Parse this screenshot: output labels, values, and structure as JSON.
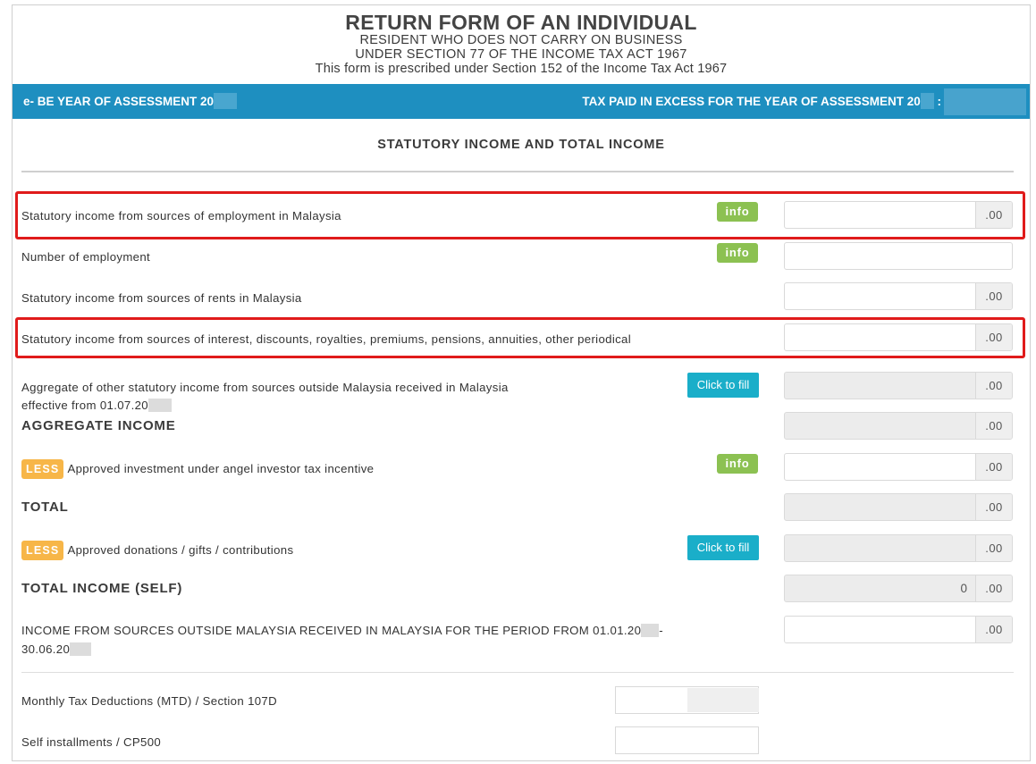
{
  "header": {
    "title": "RETURN FORM OF AN INDIVIDUAL",
    "subtitle1": "RESIDENT WHO DOES NOT CARRY ON BUSINESS",
    "subtitle2": "UNDER SECTION 77 OF THE INCOME TAX ACT 1967",
    "subtitle3": "This form is prescribed under Section 152 of the Income Tax Act 1967"
  },
  "bar": {
    "left_label": "e- BE YEAR OF ASSESSMENT 20",
    "right_label": "TAX PAID IN EXCESS FOR THE YEAR OF ASSESSMENT 20",
    "right_colon": ":"
  },
  "section": {
    "title": "STATUTORY INCOME AND TOTAL INCOME"
  },
  "buttons": {
    "info": "info",
    "click_to_fill": "Click to fill",
    "less": "LESS"
  },
  "rows": {
    "employment": {
      "label": "Statutory income from sources of employment in Malaysia",
      "suffix": ".00"
    },
    "num_employment": {
      "label": "Number of employment"
    },
    "rents": {
      "label": "Statutory income from sources of rents in Malaysia",
      "suffix": ".00"
    },
    "interest": {
      "label": "Statutory income from sources of interest, discounts, royalties, premiums, pensions, annuities, other periodical",
      "suffix": ".00"
    },
    "outside": {
      "label_line1": "Aggregate of other statutory income from sources outside Malaysia received in Malaysia",
      "label_line2": "effective from 01.07.20",
      "suffix": ".00"
    },
    "aggregate": {
      "label": "AGGREGATE INCOME",
      "suffix": ".00"
    },
    "angel": {
      "label": "Approved investment under angel investor tax incentive",
      "suffix": ".00"
    },
    "total": {
      "label": "TOTAL",
      "suffix": ".00"
    },
    "donations": {
      "label": "Approved donations / gifts / contributions",
      "suffix": ".00"
    },
    "total_income": {
      "label": "TOTAL INCOME (SELF)",
      "value": "0",
      "suffix": ".00"
    },
    "income_outside_period": {
      "label_line1": "INCOME FROM SOURCES OUTSIDE MALAYSIA RECEIVED IN MALAYSIA FOR THE PERIOD FROM 01.01.20",
      "label_line1_end": "-",
      "label_line2": "30.06.20",
      "suffix": ".00"
    },
    "mtd": {
      "label": "Monthly Tax Deductions (MTD) / Section 107D"
    },
    "cp500": {
      "label": "Self installments / CP500"
    }
  },
  "colors": {
    "bar_blue": "#1e8fc0",
    "info_green": "#8cc152",
    "fill_teal": "#1aaec9",
    "less_orange": "#f7b648",
    "highlight_red": "#e01b1b"
  }
}
